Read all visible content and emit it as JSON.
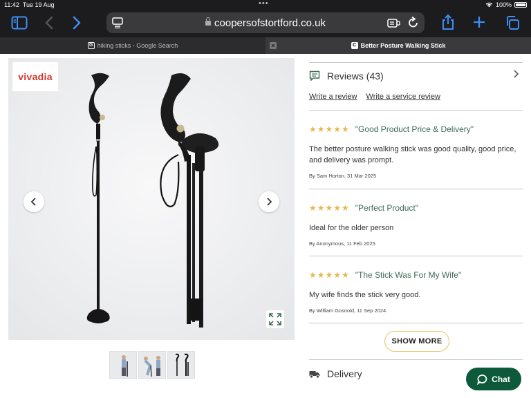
{
  "status_bar": {
    "time": "11:42",
    "date": "Tue 19 Aug",
    "battery": "100%"
  },
  "browser": {
    "url": "coopersofstortford.co.uk",
    "tabs": [
      {
        "title": "hiking sticks - Google Search",
        "favicon": "G"
      },
      {
        "title": "Better Posture Walking Stick",
        "favicon": "C"
      }
    ]
  },
  "gallery": {
    "brand_logo": "vivadia",
    "thumbnail_count": 3
  },
  "reviews": {
    "header": "Reviews (43)",
    "write_review": "Write a review",
    "write_service_review": "Write a service review",
    "items": [
      {
        "stars": "★★★★★",
        "title": "\"Good Product Price & Delivery\"",
        "body": "The better posture walking stick was good quality, good price, and delivery was prompt.",
        "by": "By Sam Horton,  31 Mar 2025"
      },
      {
        "stars": "★★★★★",
        "title": "\"Perfect Product\"",
        "body": "Ideal for the older person",
        "by": "By Anonymous,  11 Feb 2025"
      },
      {
        "stars": "★★★★★",
        "title": "\"The Stick Was For My Wife\"",
        "body": "My wife finds the stick very good.",
        "by": "By William Gosnold,  11 Sep 2024"
      }
    ],
    "show_more": "SHOW MORE",
    "rating_value": 5,
    "rating_max": 5
  },
  "delivery": {
    "label": "Delivery"
  },
  "chat": {
    "label": "Chat"
  },
  "colors": {
    "accent": "#3e8ef7",
    "brand_red": "#d8342b",
    "star": "#e6b84a",
    "review_title": "#3d6a55",
    "chat_bg": "#0d5a3a"
  }
}
